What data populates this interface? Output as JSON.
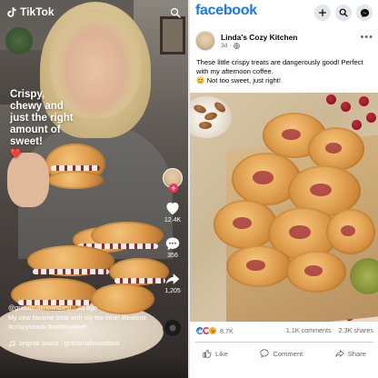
{
  "tiktok": {
    "app_name": "TikTok",
    "overlay_caption": "Crispy, chewy and just the right amount of sweet!",
    "overlay_heart": "❤️",
    "actions": [
      {
        "icon": "heart-icon",
        "count": "12.4K"
      },
      {
        "icon": "comment-icon",
        "count": "356"
      },
      {
        "icon": "share-icon",
        "count": "1,205"
      }
    ],
    "username": "@grandmaknowsbest",
    "posted": "2d ago",
    "description": "My new favorite treat with my tea time! #teatime #crispysnack #nottoosweet",
    "sound": "original sound - grandmaknowsbest"
  },
  "facebook": {
    "logo": "facebook",
    "header_icons": [
      "plus-icon",
      "search-icon",
      "messenger-icon"
    ],
    "page_name": "Linda's Cozy Kitchen",
    "post_time": "3d",
    "post_text": "These little crispy treats are dangerously good! Perfect with my afternoon coffee.",
    "post_text_2": "😊 Not too sweet, just right!",
    "reaction_count": "8.7K",
    "comments": "1.1K comments",
    "shares": "2.3K shares",
    "action_like": "Like",
    "action_comment": "Comment",
    "action_share": "Share"
  },
  "colors": {
    "facebook_blue": "#1877f2",
    "tiktok_red": "#fe2c55",
    "like_blue": "#1877f2",
    "love_red": "#f33e58",
    "haha_yellow": "#f7b125"
  }
}
